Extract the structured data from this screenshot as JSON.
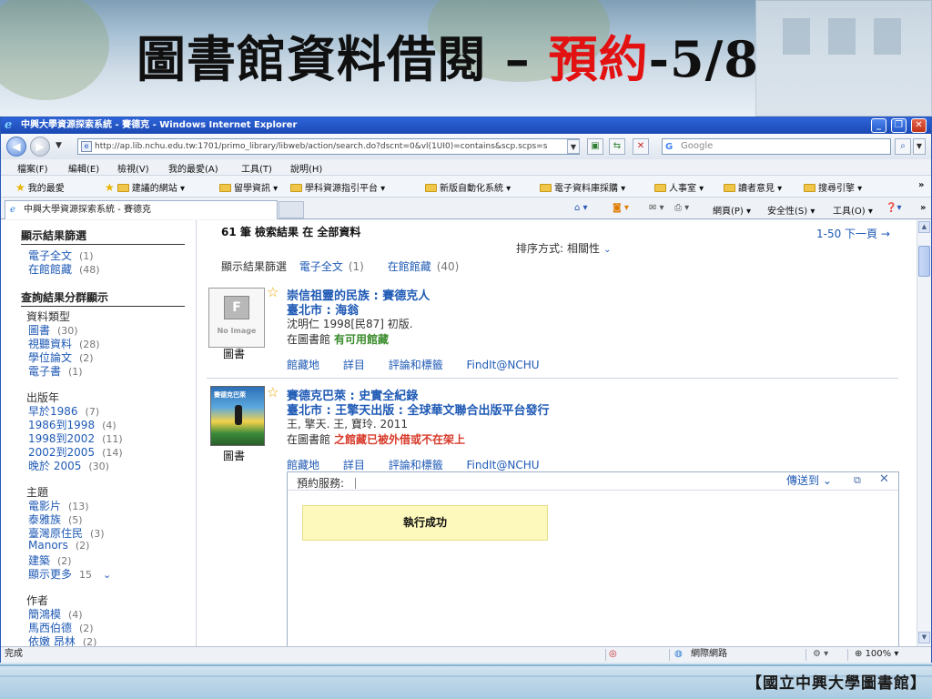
{
  "slide": {
    "title_main": "圖書館資料借閱 – ",
    "title_red": "預約",
    "title_suffix": "-5/8",
    "footer": "【國立中興大學圖書館】"
  },
  "browser": {
    "window_title": "中興大學資源探索系統 - 賽德克 - Windows Internet Explorer",
    "url": "http://ap.lib.nchu.edu.tw:1701/primo_library/libweb/action/search.do?dscnt=0&vl(1UI0)=contains&scp.scps=s",
    "search_placeholder": "Google",
    "menus": [
      "檔案(F)",
      "編輯(E)",
      "檢視(V)",
      "我的最愛(A)",
      "工具(T)",
      "說明(H)"
    ],
    "favorites": {
      "label": "我的最愛",
      "items": [
        "建議的網站 ▾",
        "留學資訊 ▾",
        "學科資源指引平台 ▾",
        "新版自動化系統 ▾",
        "電子資料庫採購 ▾",
        "人事室 ▾",
        "讀者意見 ▾",
        "搜尋引擎 ▾"
      ]
    },
    "tab_title": "中興大學資源探索系統 - 賽德克",
    "commands": {
      "page": "網頁(P) ▾",
      "safety": "安全性(S) ▾",
      "tools": "工具(O) ▾"
    },
    "status": {
      "left": "完成",
      "zone": "網際網路",
      "zoom": "100%"
    }
  },
  "sidebar": {
    "filters_title": "顯示結果篩選",
    "filters": [
      {
        "label": "電子全文",
        "count": "(1)"
      },
      {
        "label": "在館館藏",
        "count": "(48)"
      }
    ],
    "facets_title": "查詢結果分群顯示",
    "groups": [
      {
        "name": "資料類型",
        "items": [
          {
            "label": "圖書",
            "count": "(30)"
          },
          {
            "label": "視聽資料",
            "count": "(28)"
          },
          {
            "label": "學位論文",
            "count": "(2)"
          },
          {
            "label": "電子書",
            "count": "(1)"
          }
        ]
      },
      {
        "name": "出版年",
        "items": [
          {
            "label": "早於1986",
            "count": "(7)"
          },
          {
            "label": "1986到1998",
            "count": "(4)"
          },
          {
            "label": "1998到2002",
            "count": "(11)"
          },
          {
            "label": "2002到2005",
            "count": "(14)"
          },
          {
            "label": "晚於 2005",
            "count": "(30)"
          }
        ]
      },
      {
        "name": "主題",
        "items": [
          {
            "label": "電影片",
            "count": "(13)"
          },
          {
            "label": "泰雅族",
            "count": "(5)"
          },
          {
            "label": "臺灣原住民",
            "count": "(3)"
          },
          {
            "label": "Manors",
            "count": "(2)"
          },
          {
            "label": "建築",
            "count": "(2)"
          }
        ],
        "more": {
          "label": "顯示更多",
          "count": "15"
        }
      },
      {
        "name": "作者",
        "items": [
          {
            "label": "簡鴻模",
            "count": "(4)"
          },
          {
            "label": "馬西伯德",
            "count": "(2)"
          },
          {
            "label": "依嫩 昂林",
            "count": "(2)"
          }
        ]
      }
    ]
  },
  "results": {
    "summary_count": "61 筆 檢索結果 在",
    "summary_scope": "全部資料",
    "paging": "1-50 下一頁 →",
    "sort_label": "排序方式:",
    "sort_value": "相關性",
    "filter_label": "顯示結果篩選",
    "filter_items": [
      {
        "label": "電子全文",
        "count": "(1)"
      },
      {
        "label": "在館館藏",
        "count": "(40)"
      }
    ],
    "records": [
      {
        "title": "崇信祖靈的民族 : 賽德克人",
        "publisher": "臺北市 : 海翁",
        "author": "沈明仁 1998[民87] 初版.",
        "avail_prefix": "在圖書館",
        "avail_status": "有可用館藏",
        "type": "圖書",
        "no_image": "No Image",
        "tabs": [
          "館藏地",
          "詳目",
          "評論和標籤",
          "FindIt@NCHU"
        ]
      },
      {
        "title": "賽德克巴萊 : 史實全紀錄",
        "publisher": "臺北市 : 王擎天出版 : 全球華文聯合出版平台發行",
        "author": "王, 擎天. 王, 寶玲. 2011",
        "avail_prefix": "在圖書館",
        "avail_status": "之館藏已被外借或不在架上",
        "type": "圖書",
        "cover_text": "賽德克巴萊",
        "tabs": [
          "館藏地",
          "詳目",
          "評論和標籤",
          "FindIt@NCHU"
        ]
      }
    ],
    "reserve_panel": {
      "label": "預約服務:",
      "send_to": "傳送到 ⌄",
      "success": "執行成功"
    }
  },
  "colors": {
    "link": "#1f5ab5",
    "available": "#3c8d2f",
    "unavailable": "#d83a2a",
    "title_red": "#e31212",
    "success_bg": "#fdf8bb"
  }
}
